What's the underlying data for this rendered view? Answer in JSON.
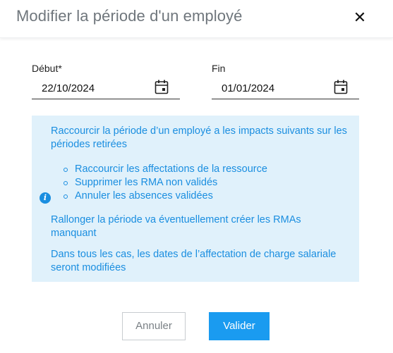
{
  "dialog": {
    "title": "Modifier la période d'un employé",
    "close_icon": "close-icon"
  },
  "fields": {
    "start": {
      "label": "Début*",
      "value": "22/10/2024",
      "icon": "calendar-icon"
    },
    "end": {
      "label": "Fin",
      "value": "01/01/2024",
      "icon": "calendar-icon"
    }
  },
  "info": {
    "icon": "info-icon",
    "intro": "Raccourcir la période d’un employé a les impacts suivants sur les périodes retirées",
    "bullets": [
      "Raccourcir les affectations de la ressource",
      "Supprimer les RMA non validés",
      "Annuler les absences validées"
    ],
    "extend": "Rallonger la période va éventuellement créer les RMAs manquant",
    "all_cases": "Dans tous les cas, les dates de l’affectation de charge salariale seront modifiées"
  },
  "buttons": {
    "cancel": "Annuler",
    "validate": "Valider"
  },
  "colors": {
    "accent": "#1a9bf0",
    "info_background": "#e0f1fb",
    "info_text": "#1a8ee0"
  }
}
